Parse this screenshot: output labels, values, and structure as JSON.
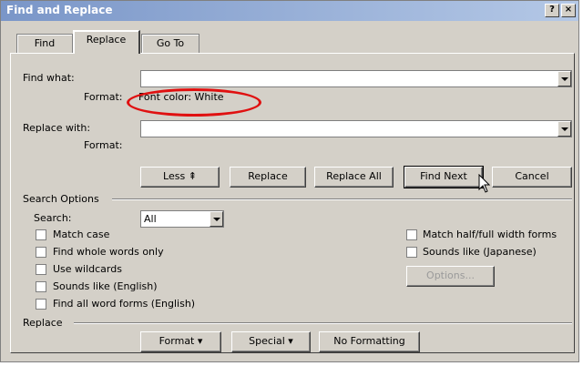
{
  "window": {
    "title": "Find and Replace",
    "help_glyph": "?",
    "close_glyph": "×"
  },
  "tabs": [
    {
      "label": "Find"
    },
    {
      "label": "Replace"
    },
    {
      "label": "Go To"
    }
  ],
  "find": {
    "label": "Find what:",
    "value": "",
    "format_label": "Format:",
    "format_value": "Font color: White"
  },
  "replace": {
    "label": "Replace with:",
    "value": "",
    "format_label": "Format:",
    "format_value": ""
  },
  "buttons": {
    "less": "Less ⇞",
    "replace": "Replace",
    "replace_all": "Replace All",
    "find_next": "Find Next",
    "cancel": "Cancel"
  },
  "search_options": {
    "heading": "Search Options",
    "search_label": "Search:",
    "search_value": "All",
    "checks_left": [
      {
        "label": "Match case",
        "checked": false
      },
      {
        "label": "Find whole words only",
        "checked": false
      },
      {
        "label": "Use wildcards",
        "checked": false
      },
      {
        "label": "Sounds like (English)",
        "checked": false
      },
      {
        "label": "Find all word forms (English)",
        "checked": false
      }
    ],
    "checks_right": [
      {
        "label": "Match half/full width forms",
        "checked": false
      },
      {
        "label": "Sounds like (Japanese)",
        "checked": false
      }
    ],
    "options_button": "Options..."
  },
  "replace_section": {
    "heading": "Replace",
    "format_button": "Format ▾",
    "special_button": "Special ▾",
    "no_formatting_button": "No Formatting"
  },
  "colors": {
    "titlebar_start": "#7a96c8",
    "titlebar_end": "#b4c8e6",
    "highlight_oval": "#e01010",
    "dialog_bg": "#d4d0c8"
  }
}
